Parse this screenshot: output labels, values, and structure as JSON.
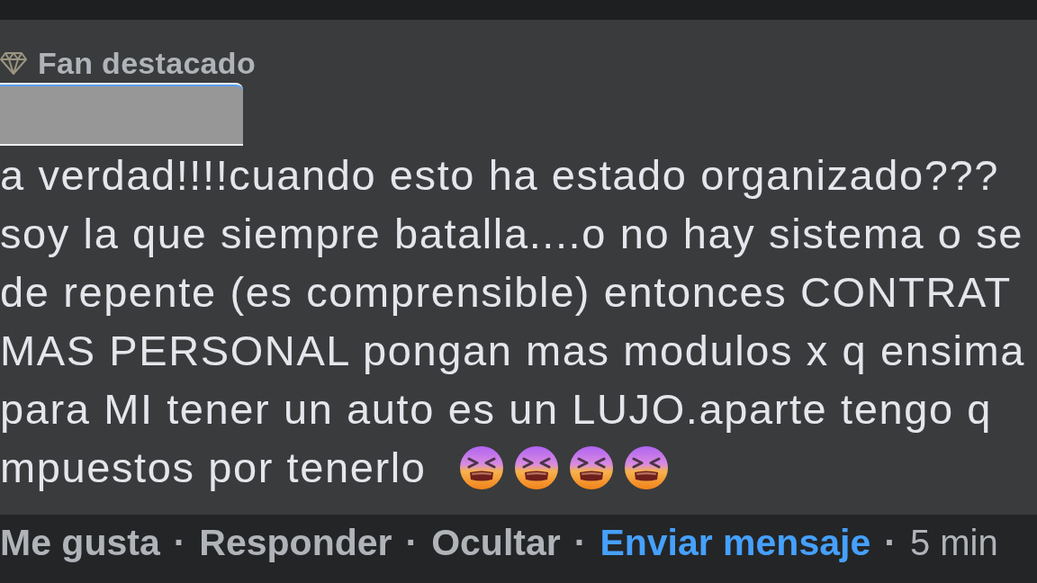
{
  "comment": {
    "badge": {
      "label": "Fan destacado"
    },
    "lines": [
      "a verdad!!!!cuando esto ha estado organizado???",
      "soy la que siempre batalla....o no hay sistema o se",
      "de repente (es comprensible) entonces CONTRAT",
      "MAS PERSONAL pongan mas modulos x q ensima",
      "para MI tener un auto es un LUJO.aparte tengo q",
      "mpuestos por tenerlo"
    ]
  },
  "actions": [
    {
      "kind": "action",
      "label": "Me gusta"
    },
    {
      "kind": "separator",
      "label": "·"
    },
    {
      "kind": "action",
      "label": "Responder"
    },
    {
      "kind": "separator",
      "label": "·"
    },
    {
      "kind": "action",
      "label": "Ocultar"
    },
    {
      "kind": "separator",
      "label": "·"
    },
    {
      "kind": "highlight",
      "label": "Enviar mensaje"
    },
    {
      "kind": "separator",
      "label": "·"
    },
    {
      "kind": "time",
      "label": "5 min"
    }
  ]
}
